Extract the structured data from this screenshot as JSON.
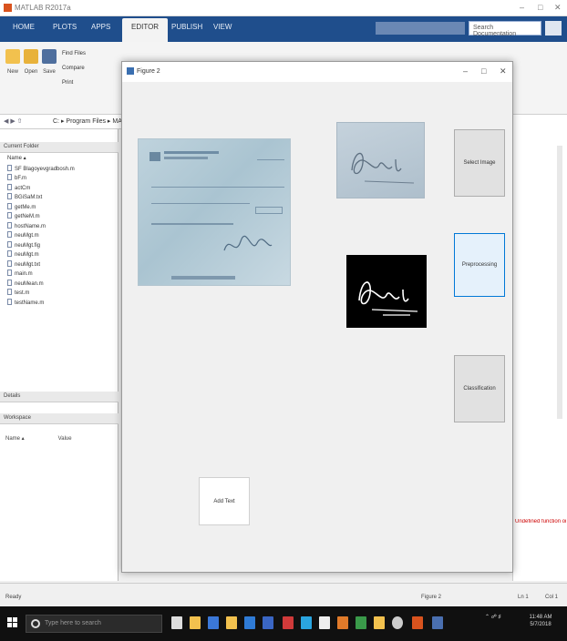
{
  "matlab": {
    "title": "MATLAB R2017a",
    "ribbon_tabs": [
      "HOME",
      "PLOTS",
      "APPS",
      "EDITOR",
      "PUBLISH",
      "VIEW"
    ],
    "active_tab_index": 3,
    "search_placeholder": "Search Documentation",
    "toolstrip": {
      "new_label": "New",
      "open_label": "Open",
      "save_label": "Save",
      "find_files": "Find Files",
      "compare": "Compare",
      "print": "Print"
    },
    "address_path": "C: ▸ Program Files ▸ MATLAB",
    "panels": {
      "current_folder": "Current Folder",
      "details": "Details",
      "workspace": "Workspace",
      "ws_name_col": "Name ▴",
      "ws_value_col": "Value"
    },
    "files": [
      "Name ▴",
      "SF Blagoyevgradbosh.m",
      "bF.m",
      "actCm",
      "BGiSaM.txt",
      "getMe.m",
      "getNeM.m",
      "hostName.m",
      "neuMgt.m",
      "neuMgt.fig",
      "neuMgt.m",
      "neuMgt.txt",
      "main.m",
      "neuMean.m",
      "test.m",
      "testName.m"
    ],
    "error_text": "Undefined function or variable 'xyz'",
    "status_left": "Ready",
    "status_mid": "Figure 2",
    "status_ln": "Ln 1",
    "status_col": "Col 1"
  },
  "taskbar": {
    "search_text": "Type here to search",
    "clock_time": "11:48 AM",
    "clock_date": "5/7/2018"
  },
  "dialog": {
    "title": "Figure 2",
    "buttons": {
      "select_image": "Select Image",
      "preprocessing": "Preprocessing",
      "classification": "Classification",
      "add_text": "Add Text"
    }
  },
  "colors": {
    "ribbon": "#1f4e8c",
    "taskbar": "#101010",
    "selected_button_border": "#0078d7"
  }
}
